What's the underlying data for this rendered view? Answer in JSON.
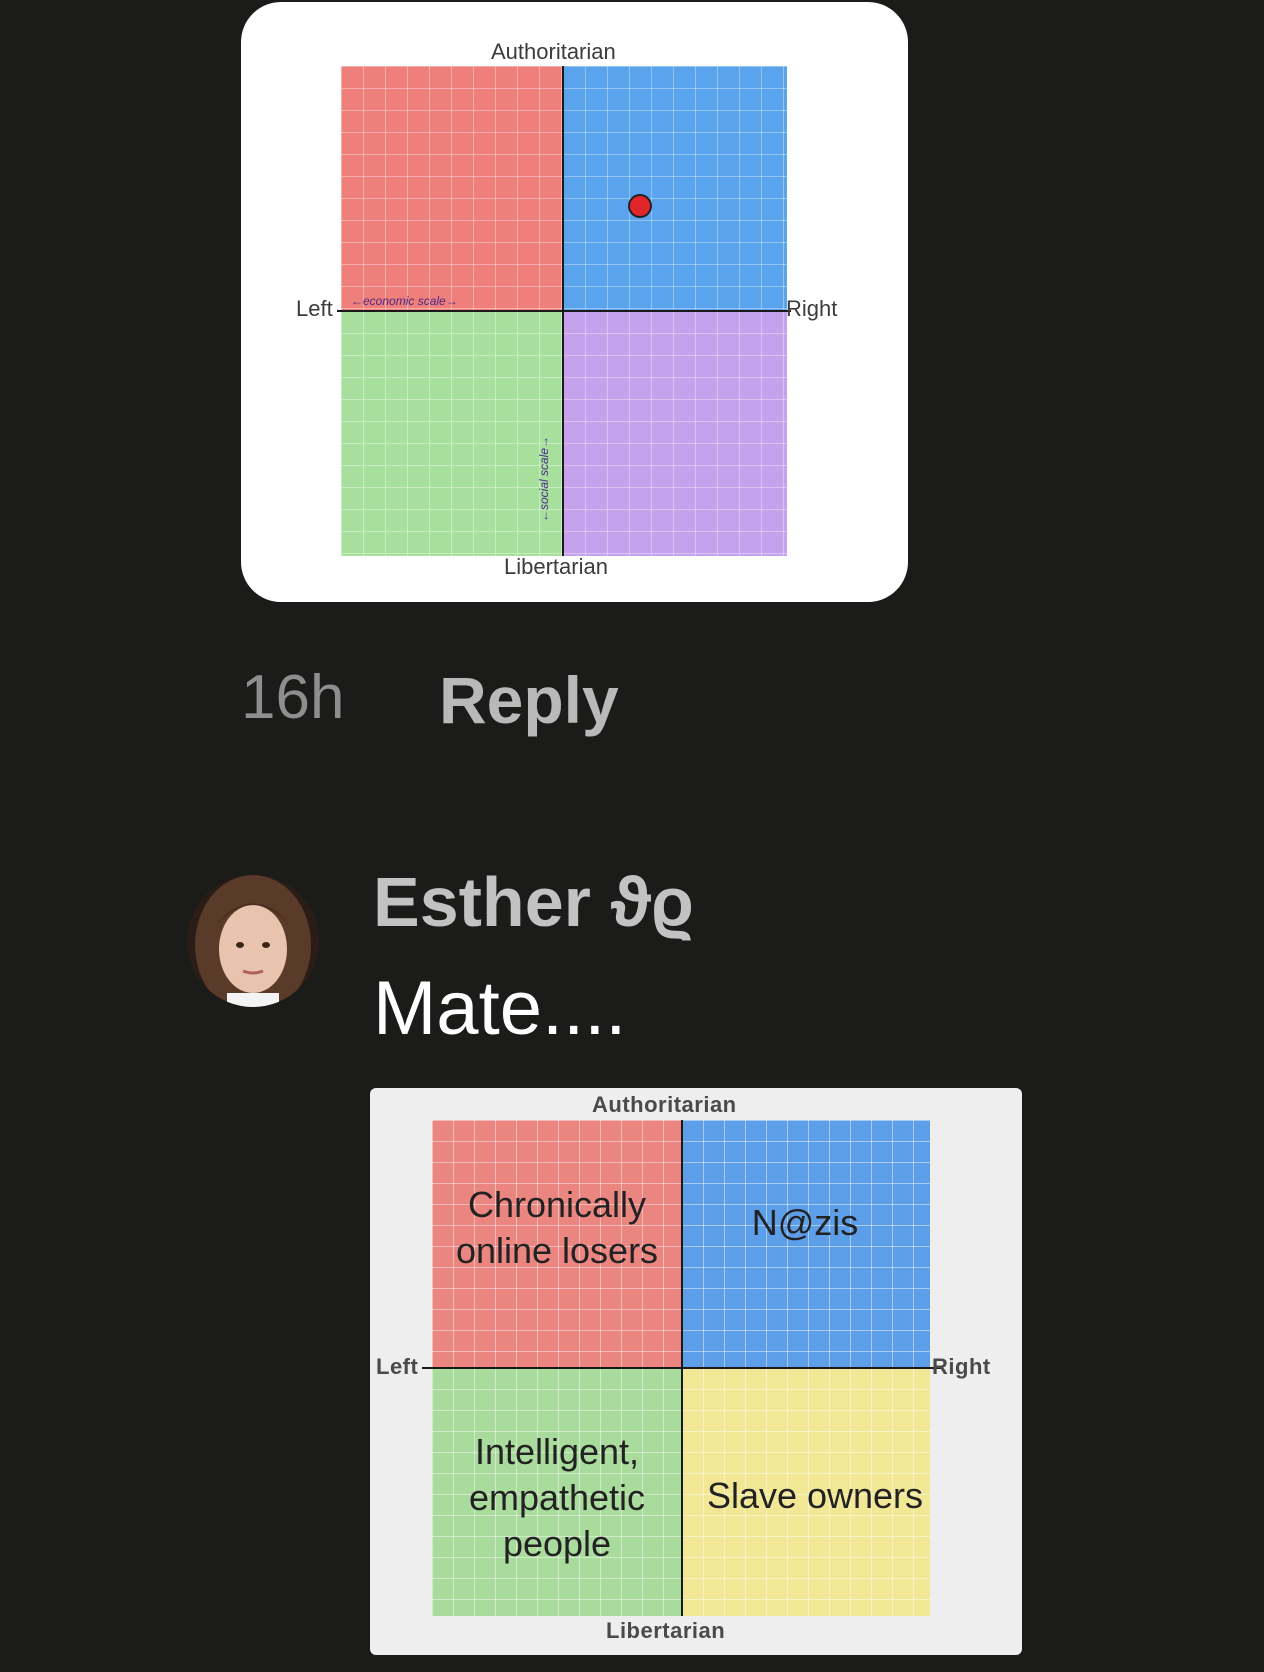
{
  "first_chart": {
    "top_label": "Authoritarian",
    "bottom_label": "Libertarian",
    "left_label": "Left",
    "right_label": "Right",
    "x_scale_label": "←economic scale→",
    "y_scale_label": "←social scale→",
    "colors": {
      "auth_left": "#ee7f7b",
      "auth_right": "#5aa4ee",
      "lib_left": "#a6e09c",
      "lib_right": "#c6a2ec",
      "dot": "#e0262a"
    },
    "chart_data": {
      "type": "scatter",
      "xlim": [
        -10,
        10
      ],
      "ylim": [
        -10,
        10
      ],
      "points": [
        {
          "x": 3.4,
          "y": 4.3
        }
      ]
    }
  },
  "comment_meta": {
    "time": "16h",
    "reply_label": "Reply"
  },
  "comment": {
    "username": "Esther ϑϱ",
    "text": "Mate...."
  },
  "second_chart": {
    "top_label": "Authoritarian",
    "bottom_label": "Libertarian",
    "left_label": "Left",
    "right_label": "Right",
    "quadrants": {
      "auth_left": "Chronically online losers",
      "auth_right": "N@zis",
      "lib_left": "Intelligent, empathetic people",
      "lib_right": "Slave owners"
    },
    "colors": {
      "auth_left": "#ea8580",
      "auth_right": "#5d9ee8",
      "lib_left": "#a9db9c",
      "lib_right": "#f1e795"
    }
  }
}
